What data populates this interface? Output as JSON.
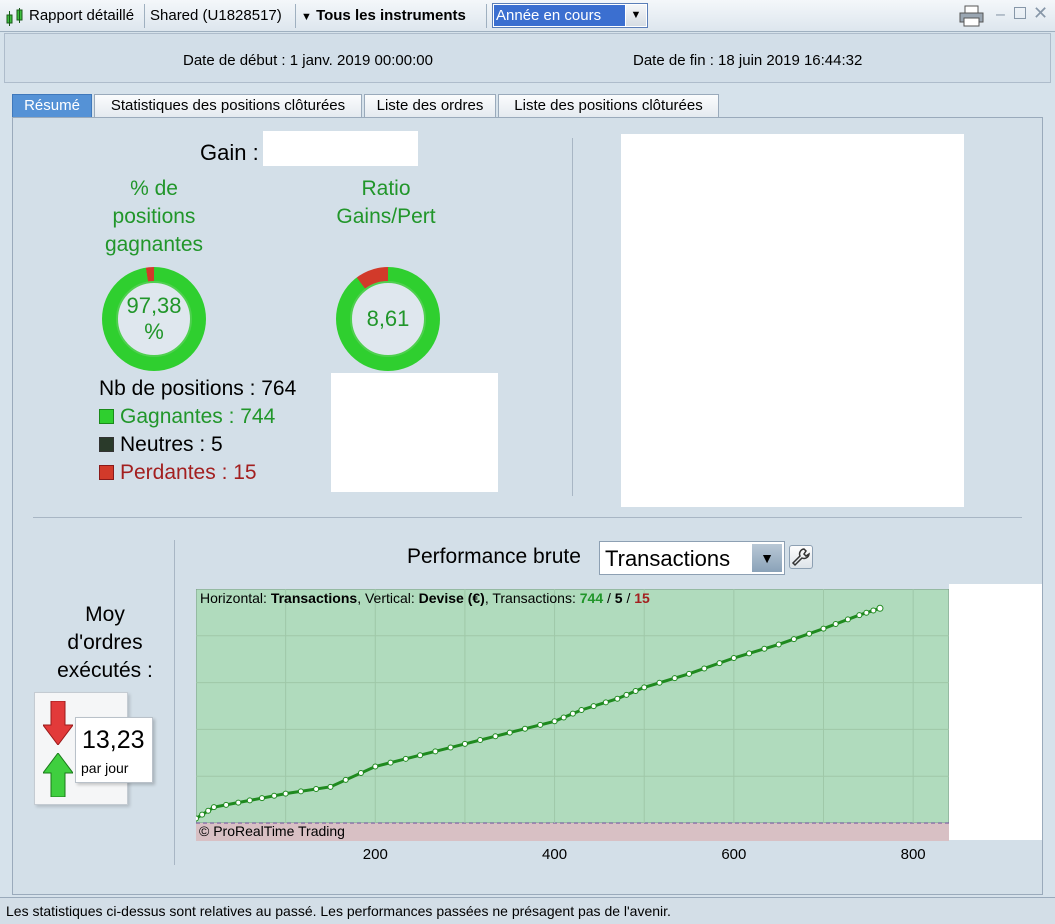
{
  "toolbar": {
    "report_label": "Rapport détaillé",
    "account_label": "Shared (U1828517)",
    "instruments_label": "Tous les instruments",
    "period_value": "Année en cours"
  },
  "dates": {
    "start": "Date de début : 1 janv. 2019 00:00:00",
    "end": "Date de fin : 18 juin 2019 16:44:32"
  },
  "tabs": [
    {
      "label": "Résumé",
      "active": true
    },
    {
      "label": "Statistiques des positions clôturées"
    },
    {
      "label": "Liste des ordres"
    },
    {
      "label": "Liste des positions clôturées"
    }
  ],
  "summary": {
    "gain_label": "Gain :",
    "win_title_1": "% de",
    "win_title_2": "positions",
    "win_title_3": "gagnantes",
    "win_value_1": "97,38",
    "win_value_2": "%",
    "win_fraction": 0.9738,
    "ratio_title_1": "Ratio",
    "ratio_title_2": "Gains/Pert",
    "ratio_value": "8,61",
    "ratio_fraction": 0.896,
    "nb_positions": "Nb de positions : 764",
    "winners": "Gagnantes : 744",
    "neutrals": "Neutres : 5",
    "losers": "Perdantes : 15"
  },
  "average": {
    "title_1": "Moy",
    "title_2": "d'ordres",
    "title_3": "exécutés :",
    "value": "13,23",
    "unit": "par jour"
  },
  "performance": {
    "label": "Performance brute",
    "select_value": "Transactions",
    "info_prefix": "Horizontal: ",
    "info_h": "Transactions",
    "info_mid": ", Vertical: ",
    "info_v": "Devise (€)",
    "info_tx": ", Transactions: ",
    "info_win": "744",
    "info_slash": " / ",
    "info_neutral": "5",
    "info_slash2": " / ",
    "info_loss": "15",
    "copyright": "© ProRealTime Trading"
  },
  "chart_data": {
    "type": "line",
    "x_ticks": [
      "200",
      "400",
      "600",
      "800"
    ],
    "xlim": [
      0,
      840
    ],
    "ylim": [
      0,
      1
    ],
    "points": [
      [
        0,
        0.02
      ],
      [
        20,
        0.07
      ],
      [
        60,
        0.1
      ],
      [
        100,
        0.13
      ],
      [
        150,
        0.16
      ],
      [
        200,
        0.25
      ],
      [
        250,
        0.3
      ],
      [
        300,
        0.35
      ],
      [
        350,
        0.4
      ],
      [
        400,
        0.45
      ],
      [
        430,
        0.5
      ],
      [
        470,
        0.55
      ],
      [
        500,
        0.6
      ],
      [
        550,
        0.66
      ],
      [
        600,
        0.73
      ],
      [
        650,
        0.79
      ],
      [
        700,
        0.86
      ],
      [
        740,
        0.92
      ],
      [
        763,
        0.95
      ]
    ]
  },
  "colors": {
    "win": "#2fcf2f",
    "neutral": "#2a3a2a",
    "loss": "#d23a2a",
    "chart_bg": "#b0dbbd",
    "chart_neg": "#d8c0c4",
    "line": "#1f8a1f"
  },
  "status": {
    "text": "Les statistiques ci-dessus sont relatives au passé. Les performances passées ne présagent pas de l'avenir."
  }
}
